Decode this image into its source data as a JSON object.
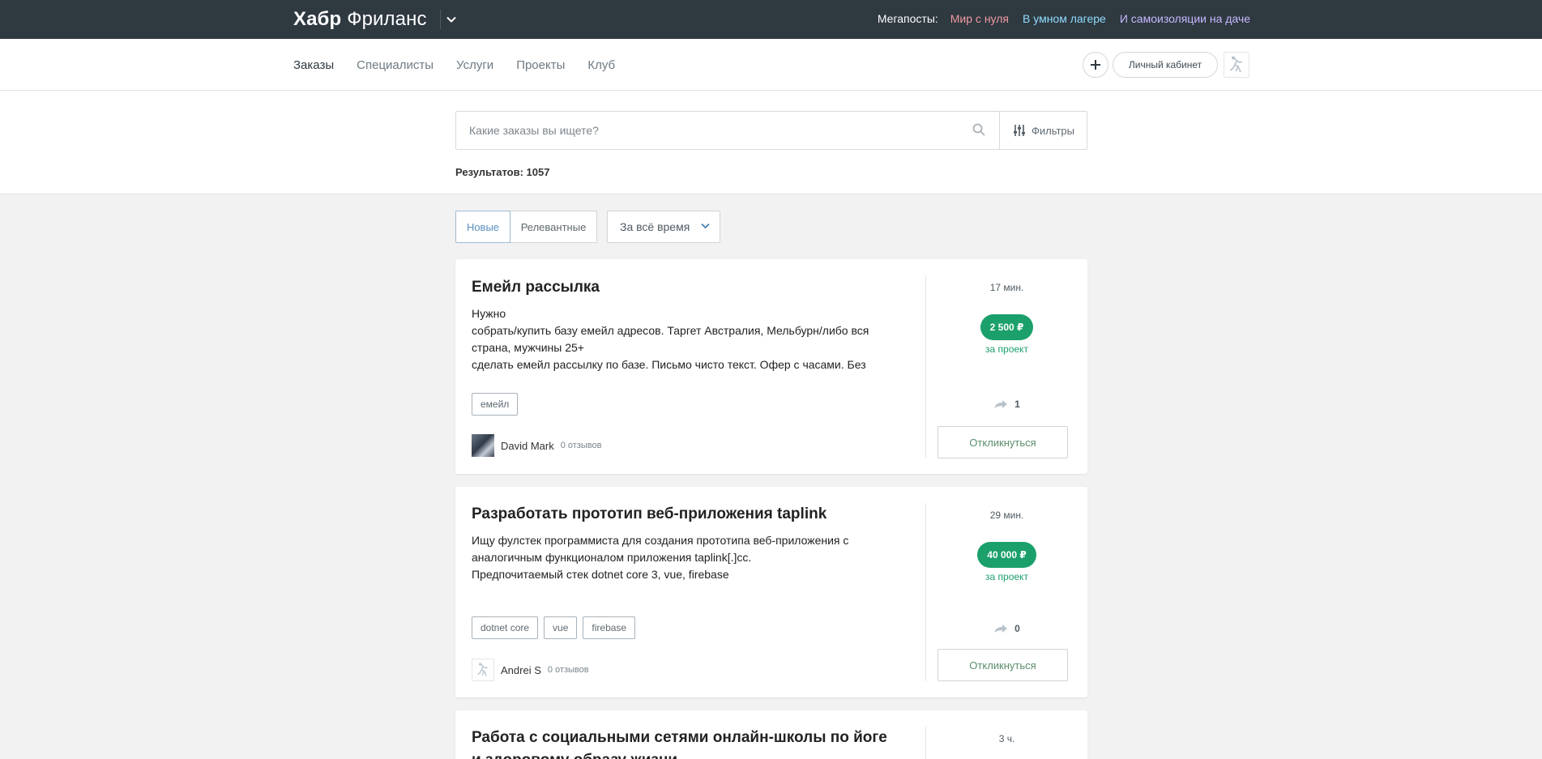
{
  "header": {
    "brand_bold": "Хабр",
    "brand_light": "Фриланс",
    "megaposts_label": "Мегапосты:",
    "megaposts": [
      {
        "label": "Мир с нуля",
        "color": "#f19aa2"
      },
      {
        "label": "В умном лагере",
        "color": "#8fdcff"
      },
      {
        "label": "И самоизоляции на даче",
        "color": "#c7b8ff"
      }
    ]
  },
  "nav": {
    "items": [
      "Заказы",
      "Специалисты",
      "Услуги",
      "Проекты",
      "Клуб"
    ],
    "active_index": 0,
    "cabinet_label": "Личный кабинет"
  },
  "search": {
    "placeholder": "Какие заказы вы ищете?",
    "value": "",
    "filters_label": "Фильтры",
    "results_text": "Результатов: 1057"
  },
  "sort": {
    "new_label": "Новые",
    "relevant_label": "Релевантные",
    "period_label": "За всё время"
  },
  "tasks": [
    {
      "title": "Емейл рассылка",
      "description": "Нужно\nсобрать/купить базу емейл адресов. Таргет Австралия, Мельбурн/либо вся страна, мужчины 25+\nсделать емейл рассылку по базе. Письмо чисто текст. Офер с часами. Без",
      "tags": [
        "емейл"
      ],
      "author": "David Mark",
      "reviews": "0 отзывов",
      "time": "17 мин.",
      "price": "2 500 ₽",
      "price_unit": "за проект",
      "shares": "1",
      "respond_label": "Откликнуться"
    },
    {
      "title": "Разработать прототип веб-приложения taplink",
      "description": "Ищу фулстек программиста для создания прототипа веб-приложения с аналогичным функционалом приложения taplink[.]cc.\nПредпочитаемый стек dotnet core 3, vue, firebase",
      "tags": [
        "dotnet core",
        "vue",
        "firebase"
      ],
      "author": "Andrei S",
      "reviews": "0 отзывов",
      "time": "29 мин.",
      "price": "40 000 ₽",
      "price_unit": "за проект",
      "shares": "0",
      "respond_label": "Откликнуться"
    },
    {
      "title": "Работа с социальными сетями онлайн-школы по йоге и здоровому образу жизни",
      "time": "3 ч."
    }
  ]
}
